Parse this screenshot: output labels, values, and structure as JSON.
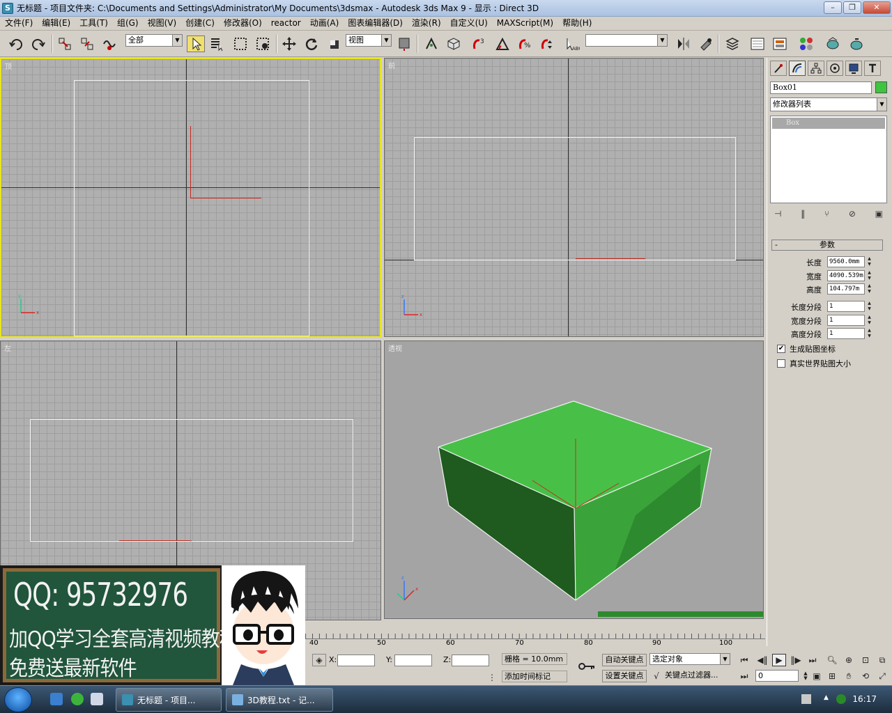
{
  "window": {
    "title": "无标题    - 项目文件夹: C:\\Documents and Settings\\Administrator\\My Documents\\3dsmax    - Autodesk 3ds Max 9    - 显示 : Direct 3D",
    "minimize": "–",
    "restore": "❐",
    "close": "✕"
  },
  "menu": [
    "文件(F)",
    "编辑(E)",
    "工具(T)",
    "组(G)",
    "视图(V)",
    "创建(C)",
    "修改器(O)",
    "reactor",
    "动画(A)",
    "图表编辑器(D)",
    "渲染(R)",
    "自定义(U)",
    "MAXScript(M)",
    "帮助(H)"
  ],
  "toolbar": {
    "selection_filter": "全部",
    "ref_coord": "视图",
    "named_selection": ""
  },
  "viewports": {
    "top": "顶",
    "front": "前",
    "left": "左",
    "perspective": "透视"
  },
  "command_panel": {
    "object_name": "Box01",
    "object_color": "#3ec43e",
    "modifier_list": "修改器列表",
    "stack_item": "Box",
    "rollout_title": "参数",
    "rollout_toggle": "-",
    "params": [
      {
        "label": "长度",
        "value": "9560.0mm"
      },
      {
        "label": "宽度",
        "value": "4090.539m"
      },
      {
        "label": "高度",
        "value": "104.797m"
      },
      {
        "label": "长度分段",
        "value": "1"
      },
      {
        "label": "宽度分段",
        "value": "1"
      },
      {
        "label": "高度分段",
        "value": "1"
      }
    ],
    "gen_mapping": "生成贴图坐标",
    "real_world": "真实世界贴图大小",
    "gen_mapping_checked": "✔"
  },
  "timeline": {
    "ticks": [
      "40",
      "50",
      "60",
      "70",
      "80",
      "90",
      "100"
    ]
  },
  "status": {
    "x_label": "X:",
    "y_label": "Y:",
    "z_label": "Z:",
    "x_value": "",
    "y_value": "",
    "z_value": "",
    "grid": "栅格 = 10.0mm",
    "add_time_tag": "添加时间标记",
    "auto_key": "自动关键点",
    "set_key": "设置关键点",
    "selected": "选定对象",
    "key_filters": "关键点过滤器...",
    "frame": "0"
  },
  "banner": {
    "qq": "QQ: 95732976",
    "line1": "加QQ学习全套高清视频教程",
    "line2": "免费送最新软件"
  },
  "taskbar": {
    "task1": "无标题    - 项目...",
    "task2": "3D教程.txt - 记...",
    "clock": "16:17"
  }
}
